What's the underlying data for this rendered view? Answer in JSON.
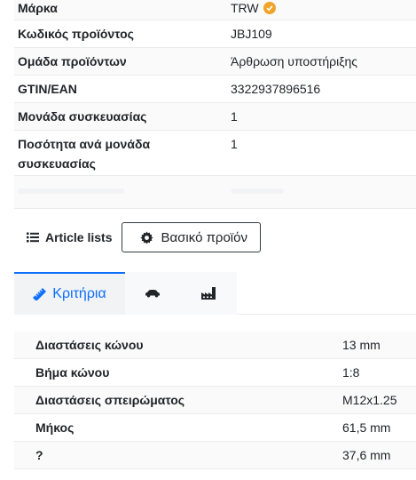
{
  "specs": [
    {
      "label": "Μάρκα",
      "value": "TRW"
    },
    {
      "label": "Κωδικός προϊόντος",
      "value": "JBJ109"
    },
    {
      "label": "Ομάδα προϊόντων",
      "value": "Άρθρωση υποστήριξης"
    },
    {
      "label": "GTIN/EAN",
      "value": "3322937896516"
    },
    {
      "label": "Μονάδα συσκευασίας",
      "value": "1"
    },
    {
      "label": "Ποσότητα ανά μονάδα συσκευασίας",
      "value": "1"
    }
  ],
  "buttons": {
    "article_lists": "Article lists",
    "base_product": "Βασικό προϊόν"
  },
  "tabs": {
    "criteria": "Κριτήρια",
    "icons": [
      "ruler-icon",
      "car-icon",
      "factory-icon"
    ]
  },
  "criteria": [
    {
      "label": "Διαστάσεις κώνου",
      "value": "13 mm"
    },
    {
      "label": "Βήμα κώνου",
      "value": "1:8"
    },
    {
      "label": "Διαστάσεις σπειρώματος",
      "value": "M12x1.25"
    },
    {
      "label": "Μήκος",
      "value": "61,5 mm"
    },
    {
      "label": "?",
      "value": "37,6 mm"
    }
  ],
  "colors": {
    "accent": "#0d6efd",
    "verified_badge": "#f0a42b",
    "text": "#212529"
  }
}
